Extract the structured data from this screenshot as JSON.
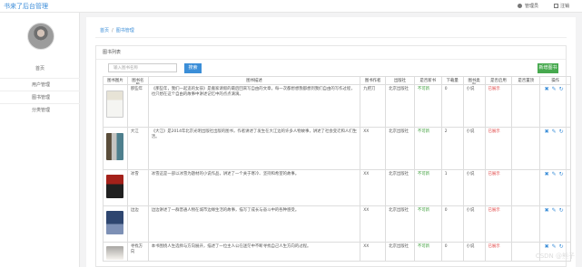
{
  "top": {
    "brand": "书来了后台管理",
    "user": "管理员",
    "logout": "注销"
  },
  "sidebar": {
    "items": [
      {
        "label": "首页"
      },
      {
        "label": "用户管理"
      },
      {
        "label": "图书管理"
      },
      {
        "label": "分类管理"
      }
    ]
  },
  "breadcrumb": {
    "home": "首页",
    "current": "图书管理"
  },
  "panel": {
    "title": "图书列表",
    "search_placeholder": "输入图书名称",
    "search_button": "搜索",
    "add_button": "新增图书"
  },
  "table": {
    "headers": [
      "图书图片",
      "图书名称",
      "图书描述",
      "图书作者",
      "出版社",
      "是否新书",
      "下载量",
      "图书类别",
      "是否启用",
      "是否置顶",
      "操作"
    ],
    "rows": [
      {
        "name": "那些年",
        "description": "《那些年，我们一起追的女孩》是搬家请假的最后回来写自由的文章，每一次都想想我都想到我们自由的写作过程，也只想在这个自由的故事中讲述记忆中的点点滴滴。",
        "author": "九把刀",
        "publisher": "北京出版社",
        "new_book": "不可新",
        "downloads": "0",
        "category": "小说",
        "enabled": "已展示"
      },
      {
        "name": "大江",
        "description": "《大江》是2014年北京光明出版社出版的图书，作者讲述了发生在大江边的许多人物故事，讲述了社会变迁和人们生活。",
        "author": "XX",
        "publisher": "北京出版社",
        "new_book": "不可新",
        "downloads": "2",
        "category": "小说",
        "enabled": "已展示"
      },
      {
        "name": "冰雪",
        "description": "冰雪这是一部以冰雪为题材的小说作品，讲述了一个关于寒冷、坚持和希望的故事。",
        "author": "XX",
        "publisher": "北京出版社",
        "new_book": "不可新",
        "downloads": "1",
        "category": "小说",
        "enabled": "已展示"
      },
      {
        "name": "边边",
        "description": "边边讲述了一群普通人物在城市边缘生活的故事，描写了成长与奋斗中的各种感受。",
        "author": "XX",
        "publisher": "北京出版社",
        "new_book": "不可新",
        "downloads": "0",
        "category": "小说",
        "enabled": "已展示"
      },
      {
        "name": "寻找方向",
        "description": "本书围绕人生选择与方向展开，描述了一位主人公在迷茫中不断寻找自己人生方向的过程。",
        "author": "XX",
        "publisher": "北京出版社",
        "new_book": "不可新",
        "downloads": "0",
        "category": "小说",
        "enabled": "已展示"
      }
    ]
  },
  "watermark": "CSDN @熊子"
}
